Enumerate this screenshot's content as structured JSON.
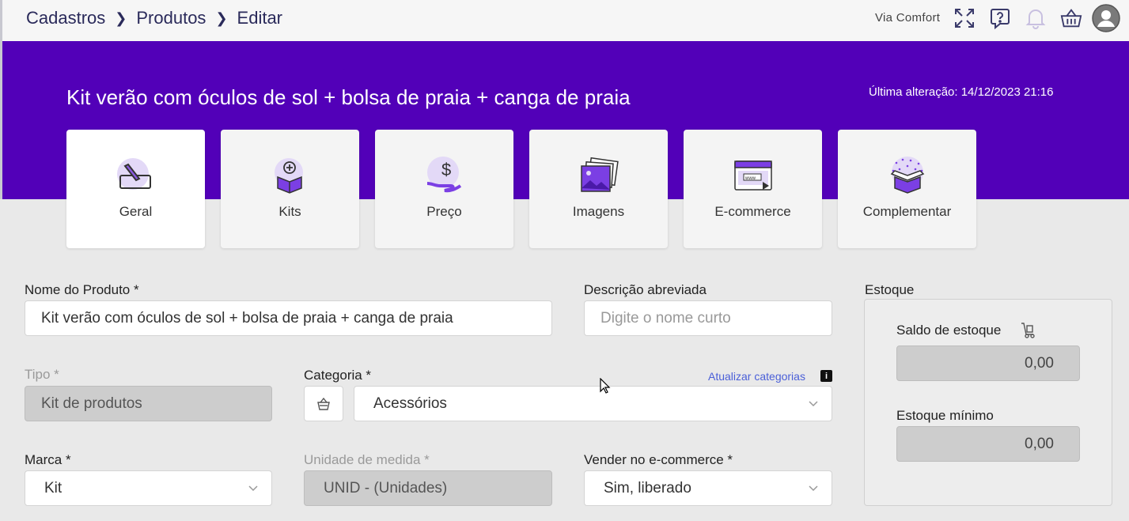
{
  "breadcrumb": [
    "Cadastros",
    "Produtos",
    "Editar"
  ],
  "topbar": {
    "company": "Via Comfort",
    "icons": [
      "expand-icon",
      "help-icon",
      "bell-icon",
      "basket-icon",
      "user-avatar-icon"
    ]
  },
  "header": {
    "title": "Kit verão com óculos de sol + bolsa de praia + canga de praia",
    "last_change": "Última alteração: 14/12/2023 21:16"
  },
  "tabs": [
    {
      "label": "Geral",
      "icon": "pencil-icon",
      "active": true
    },
    {
      "label": "Kits",
      "icon": "box-plus-icon",
      "active": false
    },
    {
      "label": "Preço",
      "icon": "money-hand-icon",
      "active": false
    },
    {
      "label": "Imagens",
      "icon": "images-icon",
      "active": false
    },
    {
      "label": "E-commerce",
      "icon": "browser-icon",
      "active": false
    },
    {
      "label": "Complementar",
      "icon": "gift-box-icon",
      "active": false
    }
  ],
  "form": {
    "nome_label": "Nome do Produto *",
    "nome_value": "Kit verão com óculos de sol + bolsa de praia + canga de praia",
    "descricao_label": "Descrição abreviada",
    "descricao_placeholder": "Digite o nome curto",
    "tipo_label": "Tipo *",
    "tipo_value": "Kit de produtos",
    "categoria_label": "Categoria *",
    "atualizar_link": "Atualizar categorias",
    "categoria_value": "Acessórios",
    "marca_label": "Marca *",
    "marca_value": "Kit",
    "unidade_label": "Unidade de medida *",
    "unidade_value": "UNID - (Unidades)",
    "vender_label": "Vender no e-commerce *",
    "vender_value": "Sim, liberado"
  },
  "estoque": {
    "title": "Estoque",
    "saldo_label": "Saldo de estoque",
    "saldo_value": "0,00",
    "minimo_label": "Estoque mínimo",
    "minimo_value": "0,00"
  },
  "colors": {
    "brand_purple": "#5200b8",
    "link_blue": "#4a5fd8",
    "icon_lilac": "#e3d9f7"
  }
}
